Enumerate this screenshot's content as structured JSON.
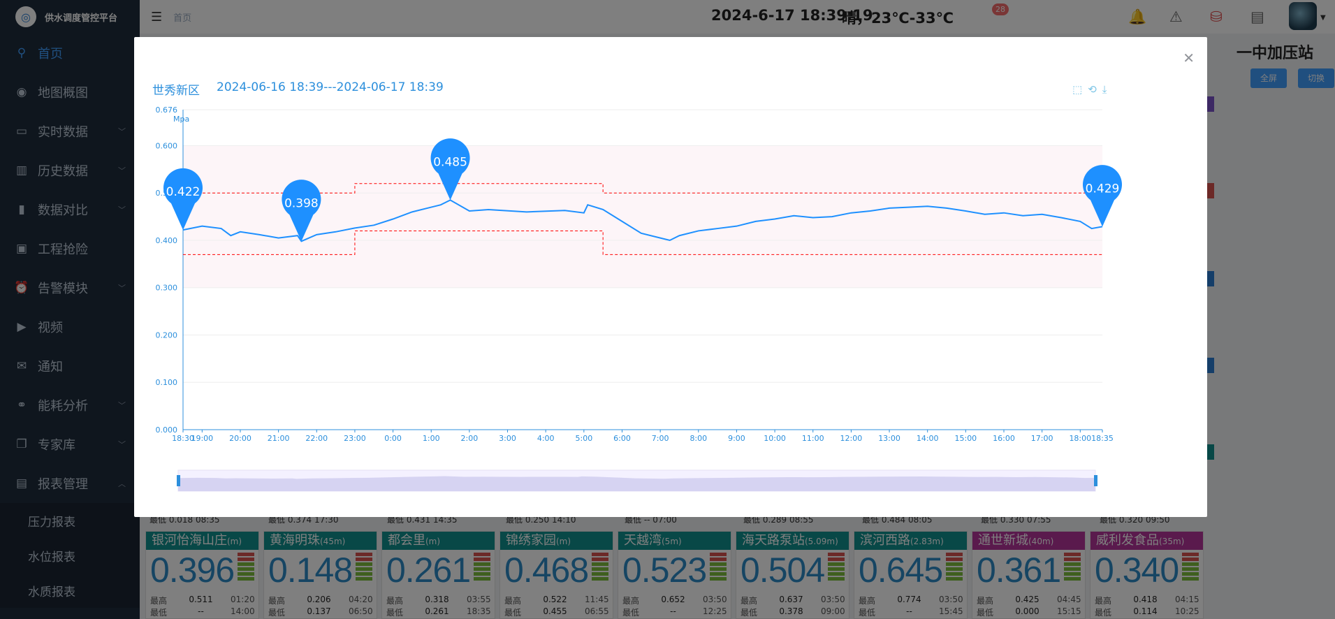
{
  "app": {
    "title": "供水调度管控平台"
  },
  "sidebar": {
    "items": [
      {
        "label": "首页",
        "icon": "location-pin-icon",
        "active": true,
        "chevron": false
      },
      {
        "label": "地图概图",
        "icon": "globe-icon",
        "chevron": false
      },
      {
        "label": "实时数据",
        "icon": "monitor-icon",
        "chevron": true
      },
      {
        "label": "历史数据",
        "icon": "bar-chart-icon",
        "chevron": true
      },
      {
        "label": "数据对比",
        "icon": "column-chart-icon",
        "chevron": true
      },
      {
        "label": "工程抢险",
        "icon": "image-icon",
        "chevron": false
      },
      {
        "label": "告警模块",
        "icon": "alarm-icon",
        "chevron": true
      },
      {
        "label": "视频",
        "icon": "video-icon",
        "chevron": false
      },
      {
        "label": "通知",
        "icon": "message-icon",
        "chevron": false
      },
      {
        "label": "能耗分析",
        "icon": "share-icon",
        "chevron": true
      },
      {
        "label": "专家库",
        "icon": "copy-icon",
        "chevron": true
      },
      {
        "label": "报表管理",
        "icon": "document-icon",
        "chevron": true
      }
    ],
    "subitems": [
      "压力报表",
      "水位报表",
      "水质报表"
    ]
  },
  "header": {
    "breadcrumb": "首页",
    "datetime": "2024-6-17 18:39:19",
    "weather": "晴，23℃-33℃",
    "notification_count": "28"
  },
  "background": {
    "station_name": "一中加压站",
    "buttons": [
      "全屏",
      "切换"
    ],
    "upper_row": [
      {
        "lbl": "最低",
        "v": "0.018",
        "t": "08:35"
      },
      {
        "lbl": "最低",
        "v": "0.374",
        "t": "17:30"
      },
      {
        "lbl": "最低",
        "v": "0.431",
        "t": "14:35"
      },
      {
        "lbl": "最低",
        "v": "0.250",
        "t": "14:10"
      },
      {
        "lbl": "最低",
        "v": "--",
        "t": "07:00"
      },
      {
        "lbl": "最低",
        "v": "0.289",
        "t": "08:55"
      },
      {
        "lbl": "最低",
        "v": "0.484",
        "t": "08:05"
      },
      {
        "lbl": "最低",
        "v": "0.330",
        "t": "07:55"
      },
      {
        "lbl": "最低",
        "v": "0.320",
        "t": "09:50"
      }
    ],
    "cards": [
      {
        "name": "银河怡海山庄",
        "unit": "(m)",
        "value": "0.396",
        "hi": "0.511",
        "hi_t": "01:20",
        "lo": "--",
        "lo_t": "14:00",
        "color": "#11908f"
      },
      {
        "name": "黄海明珠",
        "unit": "(45m)",
        "value": "0.148",
        "hi": "0.206",
        "hi_t": "04:20",
        "lo": "0.137",
        "lo_t": "06:50",
        "color": "#11908f"
      },
      {
        "name": "都会里",
        "unit": "(m)",
        "value": "0.261",
        "hi": "0.318",
        "hi_t": "03:55",
        "lo": "0.261",
        "lo_t": "18:35",
        "color": "#11908f"
      },
      {
        "name": "锦绣家园",
        "unit": "(m)",
        "value": "0.468",
        "hi": "0.522",
        "hi_t": "11:45",
        "lo": "0.455",
        "lo_t": "06:55",
        "color": "#11908f"
      },
      {
        "name": "天越湾",
        "unit": "(5m)",
        "value": "0.523",
        "hi": "0.652",
        "hi_t": "03:50",
        "lo": "--",
        "lo_t": "12:25",
        "color": "#11908f"
      },
      {
        "name": "海天路泵站",
        "unit": "(5.09m)",
        "value": "0.504",
        "hi": "0.637",
        "hi_t": "03:50",
        "lo": "0.378",
        "lo_t": "09:00",
        "color": "#11908f"
      },
      {
        "name": "滨河西路",
        "unit": "(2.83m)",
        "value": "0.645",
        "hi": "0.774",
        "hi_t": "03:50",
        "lo": "--",
        "lo_t": "15:45",
        "color": "#11908f"
      },
      {
        "name": "通世新城",
        "unit": "(40m)",
        "value": "0.361",
        "hi": "0.425",
        "hi_t": "04:45",
        "lo": "0.000",
        "lo_t": "15:15",
        "color": "#b4349b"
      },
      {
        "name": "威利发食品",
        "unit": "(35m)",
        "value": "0.340",
        "hi": "0.418",
        "hi_t": "04:15",
        "lo": "0.114",
        "lo_t": "10:25",
        "color": "#b4349b"
      }
    ],
    "hi_label": "最高",
    "lo_label": "最低"
  },
  "dialog": {
    "region": "世秀新区",
    "range": "2024-06-16 18:39---2024-06-17 18:39",
    "close_icon": "close-icon",
    "tools": [
      "zoom-area-icon",
      "zoom-reset-icon",
      "download-icon"
    ]
  },
  "chart_data": {
    "type": "line",
    "ylabel": "Mpa",
    "ylim": [
      0.0,
      0.676
    ],
    "yticks": [
      "0.676",
      "0.600",
      "0.500",
      "0.400",
      "0.300",
      "0.200",
      "0.100",
      "0.000"
    ],
    "ytick_values": [
      0.676,
      0.6,
      0.5,
      0.4,
      0.3,
      0.2,
      0.1,
      0.0
    ],
    "xticks": [
      "18:30",
      "19:00",
      "20:00",
      "21:00",
      "22:00",
      "23:00",
      "0:00",
      "1:00",
      "2:00",
      "3:00",
      "4:00",
      "5:00",
      "6:00",
      "7:00",
      "8:00",
      "9:00",
      "10:00",
      "11:00",
      "12:00",
      "13:00",
      "14:00",
      "15:00",
      "16:00",
      "17:00",
      "18:00",
      "18:35"
    ],
    "xtick_hours": [
      0,
      0.5,
      1.5,
      2.5,
      3.5,
      4.5,
      5.5,
      6.5,
      7.5,
      8.5,
      9.5,
      10.5,
      11.5,
      12.5,
      13.5,
      14.5,
      15.5,
      16.5,
      17.5,
      18.5,
      19.5,
      20.5,
      21.5,
      22.5,
      23.5,
      24.08
    ],
    "x_hours_from_start": [
      0,
      0.5,
      1,
      1.25,
      1.5,
      2,
      2.5,
      3,
      3.1,
      3.5,
      4,
      4.5,
      5,
      5.5,
      6,
      6.5,
      6.75,
      7,
      7.5,
      8,
      9,
      10,
      10.5,
      10.6,
      11,
      11.5,
      12,
      12.5,
      12.75,
      13,
      13.5,
      14,
      14.5,
      15,
      15.5,
      16,
      16.5,
      17,
      17.5,
      18,
      18.5,
      19,
      19.5,
      20,
      20.5,
      21,
      21.5,
      22,
      22.5,
      23,
      23.5,
      23.8,
      24.08
    ],
    "values": [
      0.422,
      0.43,
      0.425,
      0.41,
      0.418,
      0.412,
      0.405,
      0.41,
      0.398,
      0.412,
      0.418,
      0.426,
      0.432,
      0.445,
      0.46,
      0.47,
      0.475,
      0.485,
      0.462,
      0.465,
      0.46,
      0.463,
      0.458,
      0.475,
      0.465,
      0.44,
      0.415,
      0.405,
      0.4,
      0.41,
      0.42,
      0.425,
      0.43,
      0.44,
      0.445,
      0.452,
      0.448,
      0.45,
      0.458,
      0.462,
      0.468,
      0.47,
      0.472,
      0.468,
      0.462,
      0.455,
      0.458,
      0.452,
      0.455,
      0.448,
      0.44,
      0.425,
      0.429
    ],
    "markers": [
      {
        "label": "0.422",
        "x": 0,
        "y": 0.422
      },
      {
        "label": "0.398",
        "x": 3.1,
        "y": 0.398
      },
      {
        "label": "0.485",
        "x": 7,
        "y": 0.485
      },
      {
        "label": "0.429",
        "x": 24.08,
        "y": 0.429
      }
    ],
    "upper_limit": [
      {
        "from": 0,
        "to": 4.5,
        "value": 0.5
      },
      {
        "from": 4.5,
        "to": 11,
        "value": 0.52
      },
      {
        "from": 11,
        "to": 24.08,
        "value": 0.5
      }
    ],
    "lower_limit": [
      {
        "from": 0,
        "to": 4.5,
        "value": 0.37
      },
      {
        "from": 4.5,
        "to": 11,
        "value": 0.42
      },
      {
        "from": 11,
        "to": 24.08,
        "value": 0.37
      }
    ],
    "colors": {
      "line": "#1e90ff",
      "limit": "#ff0000",
      "band": "#fdf5f8",
      "marker": "#1e90ff"
    }
  }
}
